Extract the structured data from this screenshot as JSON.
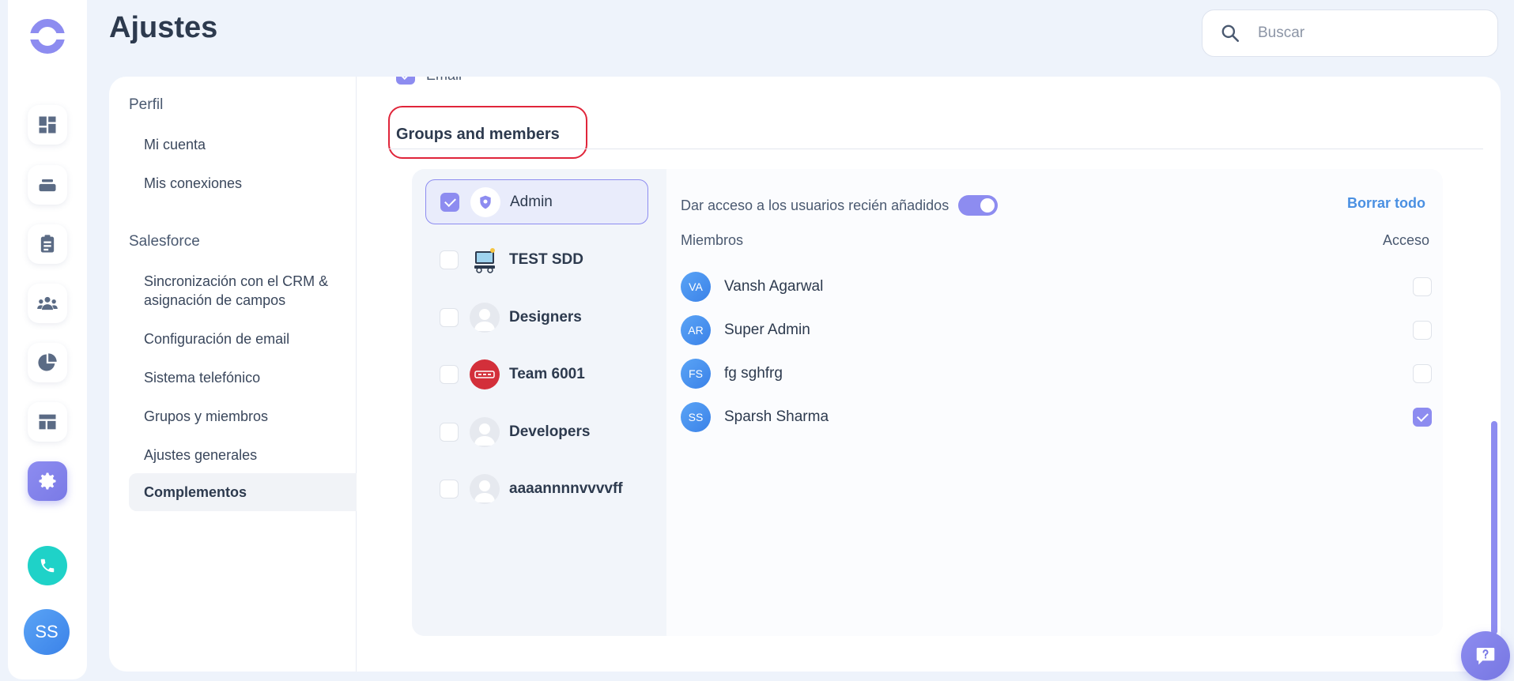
{
  "header": {
    "title": "Ajustes",
    "search_placeholder": "Buscar"
  },
  "rail": {
    "items": [
      "dashboard-icon",
      "inbox-icon",
      "clipboard-icon",
      "team-icon",
      "pie-chart-icon",
      "layout-icon",
      "settings-icon"
    ],
    "active": "settings-icon",
    "user_initials": "SS"
  },
  "nav": {
    "profile_label": "Perfil",
    "profile_items": [
      "Mi cuenta",
      "Mis conexiones"
    ],
    "salesforce_label": "Salesforce",
    "salesforce_items": [
      "Sincronización con el CRM & asignación de campos",
      "Configuración de email",
      "Sistema telefónico",
      "Grupos y miembros",
      "Ajustes generales",
      "Complementos"
    ],
    "active_item": "Complementos"
  },
  "content": {
    "email_label": "Email",
    "section_title": "Groups and members",
    "groups": [
      {
        "name": "Admin",
        "checked": true
      },
      {
        "name": "TEST SDD",
        "checked": false
      },
      {
        "name": "Designers",
        "checked": false
      },
      {
        "name": "Team 6001",
        "checked": false
      },
      {
        "name": "Developers",
        "checked": false
      },
      {
        "name": "aaaannnnvvvvff",
        "checked": false
      }
    ],
    "access_new_users_label": "Dar acceso a los usuarios recién añadidos",
    "clear_all_label": "Borrar todo",
    "members_header": "Miembros",
    "access_header": "Acceso",
    "members": [
      {
        "initials": "VA",
        "name": "Vansh Agarwal",
        "access": false
      },
      {
        "initials": "AR",
        "name": "Super Admin",
        "access": false
      },
      {
        "initials": "FS",
        "name": "fg sghfrg",
        "access": false
      },
      {
        "initials": "SS",
        "name": "Sparsh Sharma",
        "access": true
      }
    ]
  },
  "colors": {
    "accent": "#8d8cf0",
    "link": "#4a90e2",
    "highlight": "#e0253a",
    "phone": "#1fd2c8"
  }
}
